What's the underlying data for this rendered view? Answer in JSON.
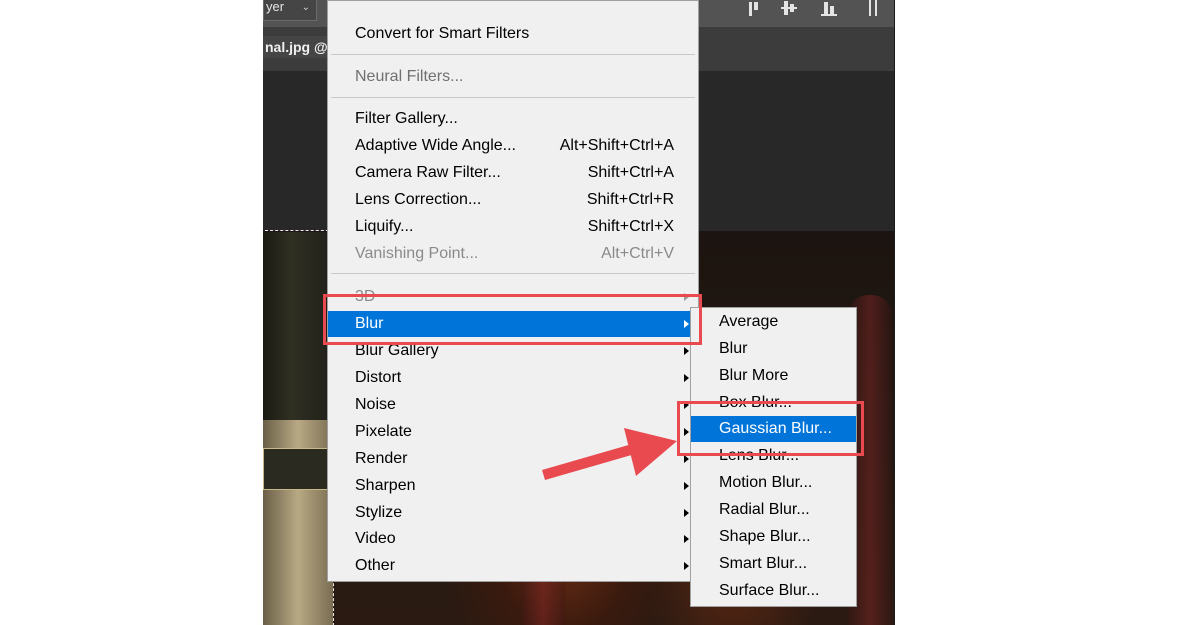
{
  "options_bar": {
    "layer_dropdown": "yer",
    "tab_title": "nal.jpg @"
  },
  "filter_menu": {
    "items": [
      {
        "label": "Convert for Smart Filters",
        "shortcut": "",
        "submenu": false,
        "disabled": false
      },
      {
        "label": "Neural Filters...",
        "shortcut": "",
        "submenu": false,
        "disabled": false
      },
      {
        "label": "Filter Gallery...",
        "shortcut": "",
        "submenu": false,
        "disabled": false
      },
      {
        "label": "Adaptive Wide Angle...",
        "shortcut": "Alt+Shift+Ctrl+A",
        "submenu": false,
        "disabled": false
      },
      {
        "label": "Camera Raw Filter...",
        "shortcut": "Shift+Ctrl+A",
        "submenu": false,
        "disabled": false
      },
      {
        "label": "Lens Correction...",
        "shortcut": "Shift+Ctrl+R",
        "submenu": false,
        "disabled": false
      },
      {
        "label": "Liquify...",
        "shortcut": "Shift+Ctrl+X",
        "submenu": false,
        "disabled": false
      },
      {
        "label": "Vanishing Point...",
        "shortcut": "Alt+Ctrl+V",
        "submenu": false,
        "disabled": true
      },
      {
        "label": "3D",
        "shortcut": "",
        "submenu": true,
        "disabled": true
      },
      {
        "label": "Blur",
        "shortcut": "",
        "submenu": true,
        "disabled": false,
        "active": true
      },
      {
        "label": "Blur Gallery",
        "shortcut": "",
        "submenu": true,
        "disabled": false
      },
      {
        "label": "Distort",
        "shortcut": "",
        "submenu": true,
        "disabled": false
      },
      {
        "label": "Noise",
        "shortcut": "",
        "submenu": true,
        "disabled": false
      },
      {
        "label": "Pixelate",
        "shortcut": "",
        "submenu": true,
        "disabled": false
      },
      {
        "label": "Render",
        "shortcut": "",
        "submenu": true,
        "disabled": false
      },
      {
        "label": "Sharpen",
        "shortcut": "",
        "submenu": true,
        "disabled": false
      },
      {
        "label": "Stylize",
        "shortcut": "",
        "submenu": true,
        "disabled": false
      },
      {
        "label": "Video",
        "shortcut": "",
        "submenu": true,
        "disabled": false
      },
      {
        "label": "Other",
        "shortcut": "",
        "submenu": true,
        "disabled": false
      }
    ]
  },
  "blur_submenu": {
    "items": [
      {
        "label": "Average",
        "active": false
      },
      {
        "label": "Blur",
        "active": false
      },
      {
        "label": "Blur More",
        "active": false
      },
      {
        "label": "Box Blur...",
        "active": false
      },
      {
        "label": "Gaussian Blur...",
        "active": true
      },
      {
        "label": "Lens Blur...",
        "active": false
      },
      {
        "label": "Motion Blur...",
        "active": false
      },
      {
        "label": "Radial Blur...",
        "active": false
      },
      {
        "label": "Shape Blur...",
        "active": false
      },
      {
        "label": "Smart Blur...",
        "active": false
      },
      {
        "label": "Surface Blur...",
        "active": false
      }
    ]
  },
  "colors": {
    "highlight": "#0074d9",
    "annotation": "#e84a4f",
    "menu_bg": "#f0f0f0"
  }
}
